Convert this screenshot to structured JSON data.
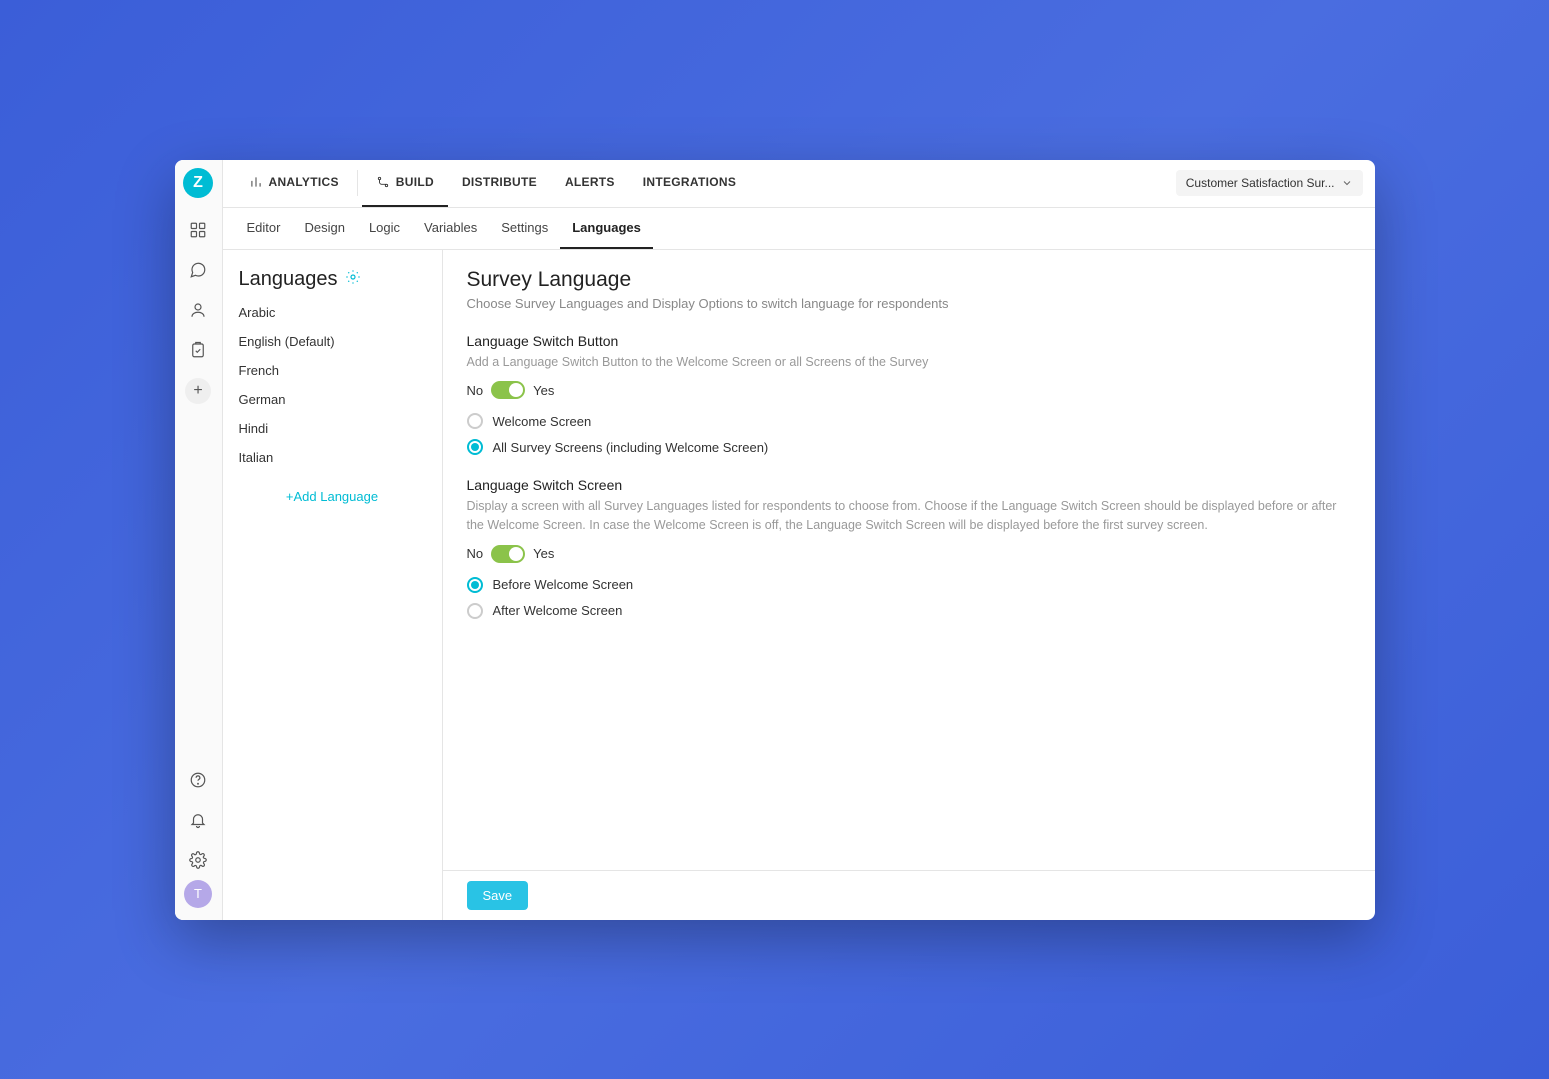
{
  "brand": {
    "letter": "Z"
  },
  "topnav": {
    "items": [
      {
        "label": "ANALYTICS",
        "icon": "analytics"
      },
      {
        "label": "BUILD",
        "icon": "build",
        "active": true
      },
      {
        "label": "DISTRIBUTE"
      },
      {
        "label": "ALERTS"
      },
      {
        "label": "INTEGRATIONS"
      }
    ],
    "survey_selector": "Customer Satisfaction Sur..."
  },
  "subnav": {
    "items": [
      {
        "label": "Editor"
      },
      {
        "label": "Design"
      },
      {
        "label": "Logic"
      },
      {
        "label": "Variables"
      },
      {
        "label": "Settings"
      },
      {
        "label": "Languages",
        "active": true
      }
    ]
  },
  "lang_sidebar": {
    "title": "Languages",
    "languages": [
      "Arabic",
      "English (Default)",
      "French",
      "German",
      "Hindi",
      "Italian"
    ],
    "add_label": "+Add Language"
  },
  "main": {
    "title": "Survey Language",
    "subtitle": "Choose Survey Languages and Display Options to switch language for respondents",
    "switch_button": {
      "title": "Language Switch Button",
      "subtitle": "Add a Language Switch Button to the Welcome Screen or all Screens of the Survey",
      "no": "No",
      "yes": "Yes",
      "options": [
        {
          "label": "Welcome Screen",
          "checked": false
        },
        {
          "label": "All Survey Screens (including Welcome Screen)",
          "checked": true
        }
      ]
    },
    "switch_screen": {
      "title": "Language Switch Screen",
      "subtitle": "Display a screen with all Survey Languages listed for respondents to choose from. Choose if the Language Switch Screen should be displayed before or after the Welcome Screen. In case the Welcome Screen is off, the Language Switch Screen will be displayed before the first survey screen.",
      "no": "No",
      "yes": "Yes",
      "options": [
        {
          "label": "Before Welcome Screen",
          "checked": true
        },
        {
          "label": "After Welcome Screen",
          "checked": false
        }
      ]
    },
    "save": "Save"
  },
  "avatar": "T"
}
